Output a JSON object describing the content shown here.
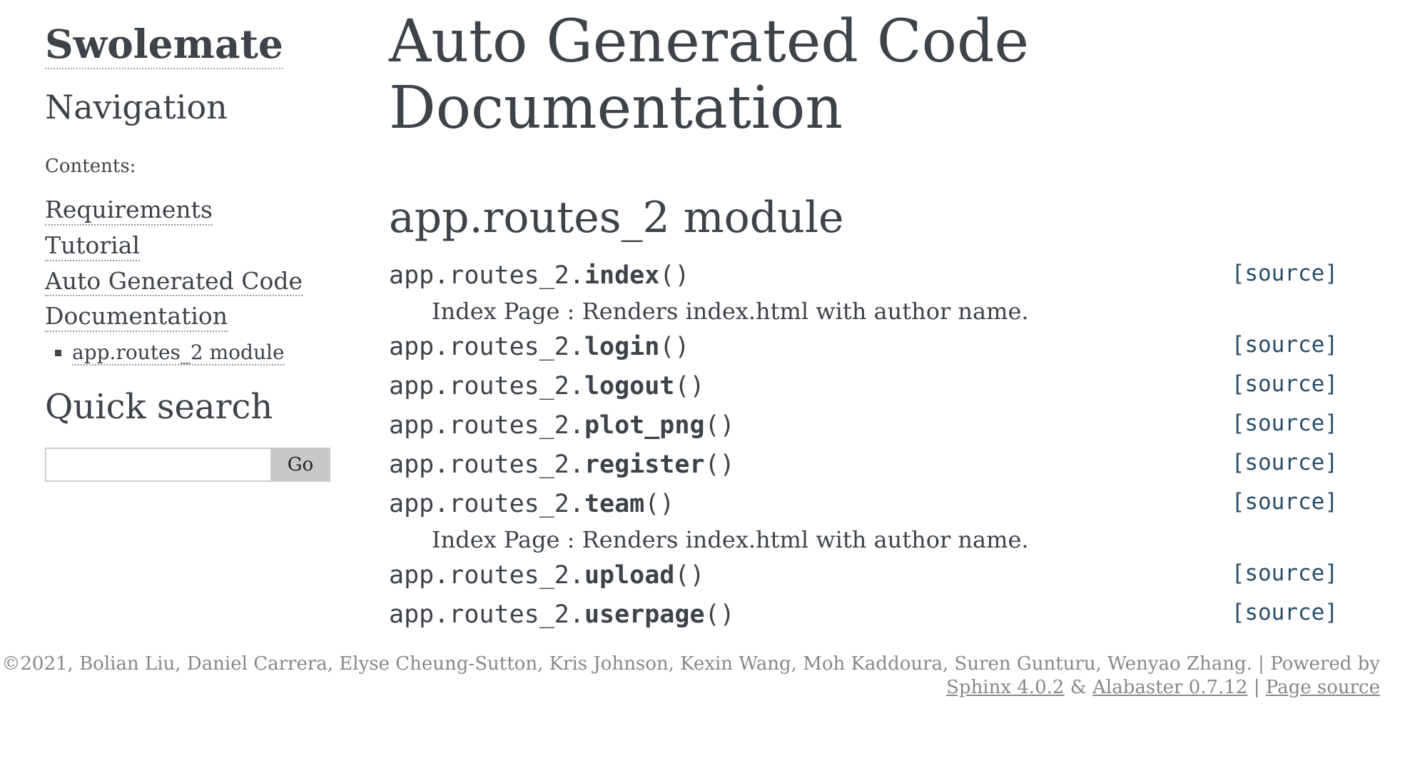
{
  "sidebar": {
    "logo": "Swolemate",
    "nav_heading": "Navigation",
    "contents_caption": "Contents:",
    "toc": [
      {
        "label": "Requirements"
      },
      {
        "label": "Tutorial"
      },
      {
        "label": "Auto Generated Code"
      },
      {
        "label": "Documentation"
      }
    ],
    "toc_sub": [
      {
        "label": "app.routes_2 module"
      }
    ],
    "quick_search_heading": "Quick search",
    "search_value": "",
    "go_label": "Go"
  },
  "main": {
    "title_line1": "Auto Generated Code",
    "title_line2": "Documentation",
    "module_title": "app.routes_2 module",
    "source_label": "[source]",
    "functions": [
      {
        "prefix": "app.routes_2.",
        "name": "index",
        "args": "()",
        "desc": "Index Page : Renders index.html with author name."
      },
      {
        "prefix": "app.routes_2.",
        "name": "login",
        "args": "()",
        "desc": ""
      },
      {
        "prefix": "app.routes_2.",
        "name": "logout",
        "args": "()",
        "desc": ""
      },
      {
        "prefix": "app.routes_2.",
        "name": "plot_png",
        "args": "()",
        "desc": ""
      },
      {
        "prefix": "app.routes_2.",
        "name": "register",
        "args": "()",
        "desc": ""
      },
      {
        "prefix": "app.routes_2.",
        "name": "team",
        "args": "()",
        "desc": "Index Page : Renders index.html with author name."
      },
      {
        "prefix": "app.routes_2.",
        "name": "upload",
        "args": "()",
        "desc": ""
      },
      {
        "prefix": "app.routes_2.",
        "name": "userpage",
        "args": "()",
        "desc": ""
      }
    ]
  },
  "footer": {
    "copyright": "©2021, Bolian Liu, Daniel Carrera, Elyse Cheung-Sutton, Kris Johnson, Kexin Wang, Moh Kaddoura, Suren Gunturu, Wenyao Zhang.",
    "sep1": "|",
    "powered_by": "Powered by",
    "sphinx": "Sphinx 4.0.2",
    "amp": "&",
    "alabaster": "Alabaster 0.7.12",
    "sep2": "|",
    "page_source": "Page source"
  }
}
